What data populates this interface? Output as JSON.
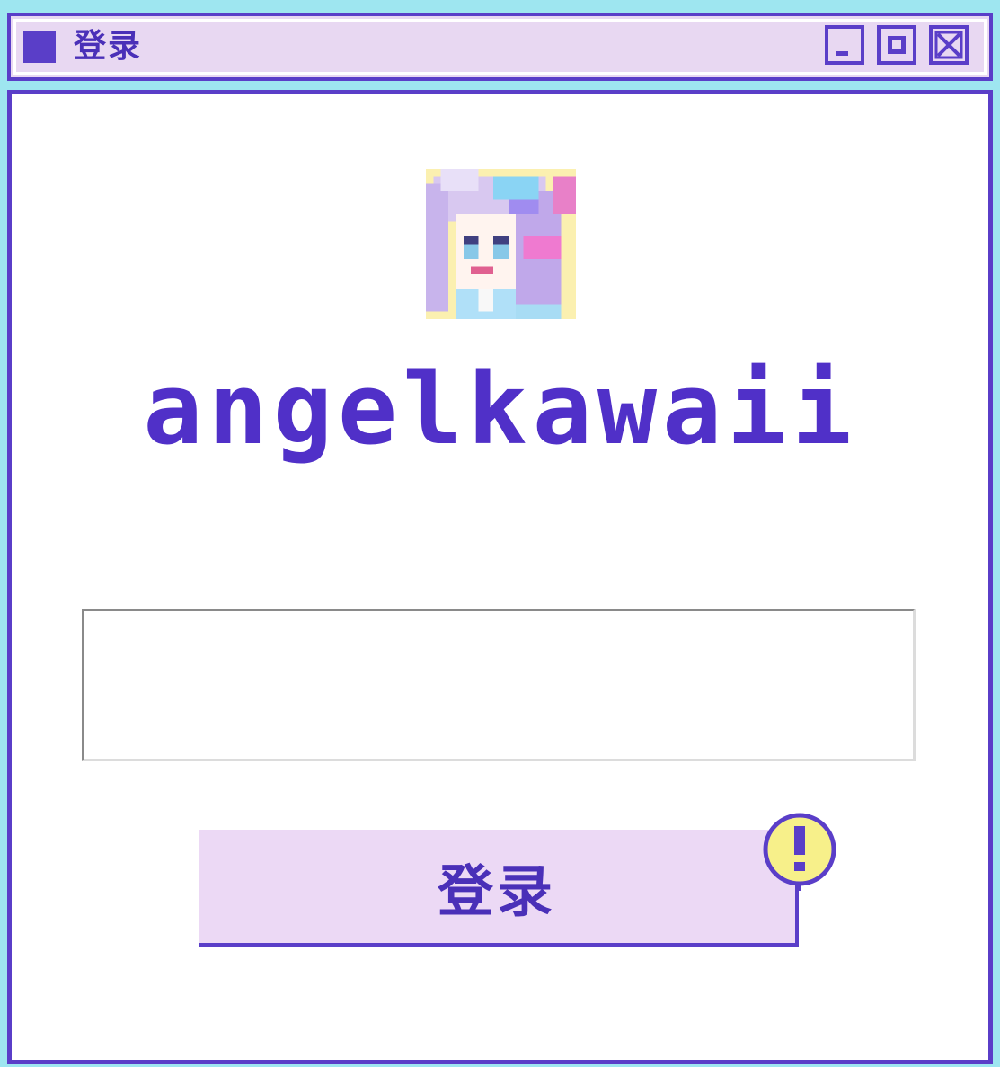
{
  "window": {
    "title": "登录",
    "controls": {
      "minimize_icon": "minimize-icon",
      "maximize_icon": "maximize-icon",
      "close_icon": "close-icon"
    }
  },
  "profile": {
    "avatar_icon": "pixel-anime-girl-avatar",
    "username": "angelkawaii"
  },
  "login": {
    "input_value": "",
    "button_label": "登录",
    "alert_icon": "exclamation-icon"
  },
  "colors": {
    "accent": "#5a3ec8",
    "titlebar_bg": "#e8d8f2",
    "frame": "#9ee6f0",
    "button_bg": "#ecd9f5",
    "alert_yellow": "#f7f08a"
  }
}
